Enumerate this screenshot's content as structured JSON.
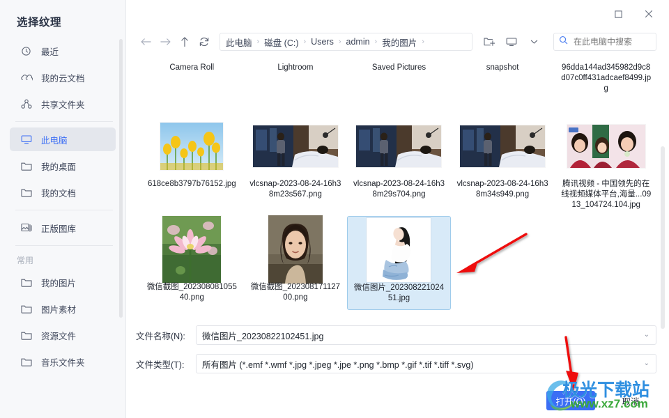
{
  "sidebar": {
    "title": "选择纹理",
    "items": [
      {
        "label": "最近",
        "icon": "clock-icon",
        "active": false
      },
      {
        "label": "我的云文档",
        "icon": "cloud-icon",
        "active": false
      },
      {
        "label": "共享文件夹",
        "icon": "share-icon",
        "active": false
      },
      {
        "label": "此电脑",
        "icon": "monitor-icon",
        "active": true
      },
      {
        "label": "我的桌面",
        "icon": "folder-icon",
        "active": false
      },
      {
        "label": "我的文档",
        "icon": "folder-icon",
        "active": false
      },
      {
        "label": "正版图库",
        "icon": "image-library-icon",
        "active": false
      }
    ],
    "group_label": "常用",
    "group_items": [
      {
        "label": "我的图片",
        "icon": "folder-icon"
      },
      {
        "label": "图片素材",
        "icon": "folder-icon"
      },
      {
        "label": "资源文件",
        "icon": "folder-icon"
      },
      {
        "label": "音乐文件夹",
        "icon": "folder-icon"
      }
    ]
  },
  "titlebar": {
    "maximize_label": "□",
    "close_label": "✕"
  },
  "toolbar": {
    "back": "back-arrow-icon",
    "forward": "forward-arrow-icon",
    "up": "up-arrow-icon",
    "refresh": "refresh-icon",
    "breadcrumb": [
      "此电脑",
      "磁盘 (C:)",
      "Users",
      "admin",
      "我的图片"
    ],
    "breadcrumb_separator": "›",
    "new_folder": "new-folder-icon",
    "view_mode": "view-mode-icon",
    "view_mode_caret": "⌄",
    "search_placeholder": "在此电脑中搜索"
  },
  "files": {
    "row1": [
      {
        "name": "Camera Roll",
        "type": "folder"
      },
      {
        "name": "Lightroom",
        "type": "folder"
      },
      {
        "name": "Saved Pictures",
        "type": "folder"
      },
      {
        "name": "snapshot",
        "type": "folder"
      },
      {
        "name": "96dda144ad345982d9c8d07c0ff431adcaef8499.jpg",
        "type": "file"
      }
    ],
    "row2": [
      {
        "name": "618ce8b3797b76152.jpg",
        "type": "image",
        "thumb": "tulips"
      },
      {
        "name": "vlcsnap-2023-08-24-16h38m23s567.png",
        "type": "image",
        "thumb": "bedroom"
      },
      {
        "name": "vlcsnap-2023-08-24-16h38m29s704.png",
        "type": "image",
        "thumb": "bedroom"
      },
      {
        "name": "vlcsnap-2023-08-24-16h38m34s949.png",
        "type": "image",
        "thumb": "bedroom"
      },
      {
        "name": "腾讯视频 - 中国领先的在线视频媒体平台,海量...0913_104724.104.jpg",
        "type": "image",
        "thumb": "people"
      }
    ],
    "row3": [
      {
        "name": "微信截图_20230808105540.png",
        "type": "image",
        "thumb": "lotus",
        "selected": false
      },
      {
        "name": "微信截图_20230817112700.png",
        "type": "image",
        "thumb": "portrait",
        "selected": false
      },
      {
        "name": "微信图片_20230822102451.jpg",
        "type": "image",
        "thumb": "illustration",
        "selected": true
      }
    ]
  },
  "form": {
    "filename_label": "文件名称(N):",
    "filename_value": "微信图片_20230822102451.jpg",
    "filetype_label": "文件类型(T):",
    "filetype_value": "所有图片 (*.emf *.wmf *.jpg *.jpeg *.jpe *.png *.bmp *.gif *.tif *.tiff *.svg)",
    "dropdown_caret": "⌄"
  },
  "footer": {
    "open_label": "打开(O)",
    "cancel_label": "取消"
  },
  "watermark": {
    "cn": "极光下载站",
    "en": "www.xz7.com"
  },
  "colors": {
    "accent": "#3b6ef5",
    "selection_bg": "#d8eaf8",
    "selection_border": "#9ecbeb",
    "sidebar_bg": "#f7f8fa",
    "arrow_red": "#ee1111"
  }
}
